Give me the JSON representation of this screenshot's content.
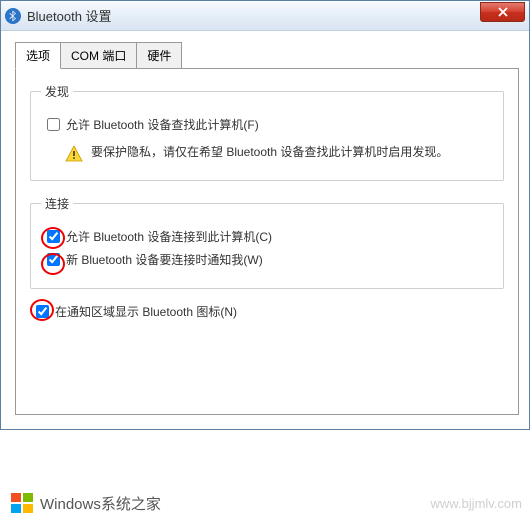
{
  "window": {
    "title": "Bluetooth 设置"
  },
  "tabs": {
    "options": "选项",
    "com": "COM 端口",
    "hardware": "硬件"
  },
  "discovery": {
    "legend": "发现",
    "allow_discover": "允许 Bluetooth 设备查找此计算机(F)",
    "warning": "要保护隐私，请仅在希望 Bluetooth 设备查找此计算机时启用发现。"
  },
  "connection": {
    "legend": "连接",
    "allow_connect": "允许 Bluetooth 设备连接到此计算机(C)",
    "notify_connect": "新 Bluetooth 设备要连接时通知我(W)"
  },
  "tray_icon": "在通知区域显示 Bluetooth 图标(N)",
  "watermark": {
    "brand": "Windows系统之家",
    "url": "www.bjjmlv.com"
  }
}
